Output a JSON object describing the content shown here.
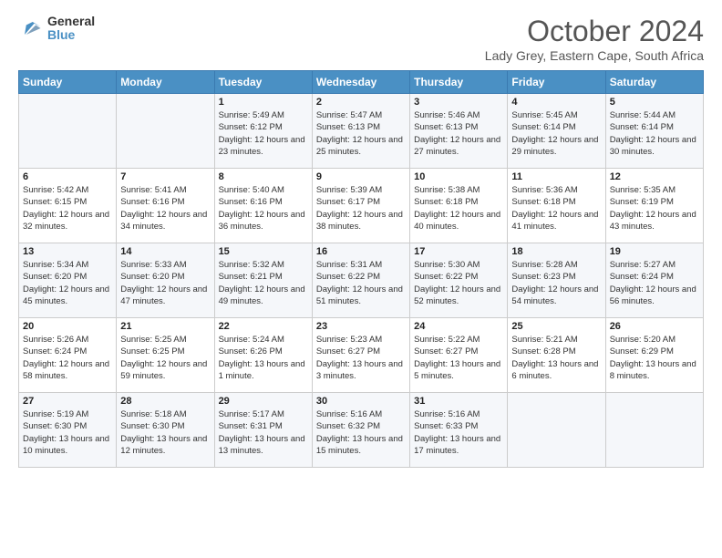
{
  "header": {
    "logo_general": "General",
    "logo_blue": "Blue",
    "month_title": "October 2024",
    "location": "Lady Grey, Eastern Cape, South Africa"
  },
  "days_of_week": [
    "Sunday",
    "Monday",
    "Tuesday",
    "Wednesday",
    "Thursday",
    "Friday",
    "Saturday"
  ],
  "weeks": [
    [
      {
        "day": "",
        "info": ""
      },
      {
        "day": "",
        "info": ""
      },
      {
        "day": "1",
        "info": "Sunrise: 5:49 AM\nSunset: 6:12 PM\nDaylight: 12 hours and 23 minutes."
      },
      {
        "day": "2",
        "info": "Sunrise: 5:47 AM\nSunset: 6:13 PM\nDaylight: 12 hours and 25 minutes."
      },
      {
        "day": "3",
        "info": "Sunrise: 5:46 AM\nSunset: 6:13 PM\nDaylight: 12 hours and 27 minutes."
      },
      {
        "day": "4",
        "info": "Sunrise: 5:45 AM\nSunset: 6:14 PM\nDaylight: 12 hours and 29 minutes."
      },
      {
        "day": "5",
        "info": "Sunrise: 5:44 AM\nSunset: 6:14 PM\nDaylight: 12 hours and 30 minutes."
      }
    ],
    [
      {
        "day": "6",
        "info": "Sunrise: 5:42 AM\nSunset: 6:15 PM\nDaylight: 12 hours and 32 minutes."
      },
      {
        "day": "7",
        "info": "Sunrise: 5:41 AM\nSunset: 6:16 PM\nDaylight: 12 hours and 34 minutes."
      },
      {
        "day": "8",
        "info": "Sunrise: 5:40 AM\nSunset: 6:16 PM\nDaylight: 12 hours and 36 minutes."
      },
      {
        "day": "9",
        "info": "Sunrise: 5:39 AM\nSunset: 6:17 PM\nDaylight: 12 hours and 38 minutes."
      },
      {
        "day": "10",
        "info": "Sunrise: 5:38 AM\nSunset: 6:18 PM\nDaylight: 12 hours and 40 minutes."
      },
      {
        "day": "11",
        "info": "Sunrise: 5:36 AM\nSunset: 6:18 PM\nDaylight: 12 hours and 41 minutes."
      },
      {
        "day": "12",
        "info": "Sunrise: 5:35 AM\nSunset: 6:19 PM\nDaylight: 12 hours and 43 minutes."
      }
    ],
    [
      {
        "day": "13",
        "info": "Sunrise: 5:34 AM\nSunset: 6:20 PM\nDaylight: 12 hours and 45 minutes."
      },
      {
        "day": "14",
        "info": "Sunrise: 5:33 AM\nSunset: 6:20 PM\nDaylight: 12 hours and 47 minutes."
      },
      {
        "day": "15",
        "info": "Sunrise: 5:32 AM\nSunset: 6:21 PM\nDaylight: 12 hours and 49 minutes."
      },
      {
        "day": "16",
        "info": "Sunrise: 5:31 AM\nSunset: 6:22 PM\nDaylight: 12 hours and 51 minutes."
      },
      {
        "day": "17",
        "info": "Sunrise: 5:30 AM\nSunset: 6:22 PM\nDaylight: 12 hours and 52 minutes."
      },
      {
        "day": "18",
        "info": "Sunrise: 5:28 AM\nSunset: 6:23 PM\nDaylight: 12 hours and 54 minutes."
      },
      {
        "day": "19",
        "info": "Sunrise: 5:27 AM\nSunset: 6:24 PM\nDaylight: 12 hours and 56 minutes."
      }
    ],
    [
      {
        "day": "20",
        "info": "Sunrise: 5:26 AM\nSunset: 6:24 PM\nDaylight: 12 hours and 58 minutes."
      },
      {
        "day": "21",
        "info": "Sunrise: 5:25 AM\nSunset: 6:25 PM\nDaylight: 12 hours and 59 minutes."
      },
      {
        "day": "22",
        "info": "Sunrise: 5:24 AM\nSunset: 6:26 PM\nDaylight: 13 hours and 1 minute."
      },
      {
        "day": "23",
        "info": "Sunrise: 5:23 AM\nSunset: 6:27 PM\nDaylight: 13 hours and 3 minutes."
      },
      {
        "day": "24",
        "info": "Sunrise: 5:22 AM\nSunset: 6:27 PM\nDaylight: 13 hours and 5 minutes."
      },
      {
        "day": "25",
        "info": "Sunrise: 5:21 AM\nSunset: 6:28 PM\nDaylight: 13 hours and 6 minutes."
      },
      {
        "day": "26",
        "info": "Sunrise: 5:20 AM\nSunset: 6:29 PM\nDaylight: 13 hours and 8 minutes."
      }
    ],
    [
      {
        "day": "27",
        "info": "Sunrise: 5:19 AM\nSunset: 6:30 PM\nDaylight: 13 hours and 10 minutes."
      },
      {
        "day": "28",
        "info": "Sunrise: 5:18 AM\nSunset: 6:30 PM\nDaylight: 13 hours and 12 minutes."
      },
      {
        "day": "29",
        "info": "Sunrise: 5:17 AM\nSunset: 6:31 PM\nDaylight: 13 hours and 13 minutes."
      },
      {
        "day": "30",
        "info": "Sunrise: 5:16 AM\nSunset: 6:32 PM\nDaylight: 13 hours and 15 minutes."
      },
      {
        "day": "31",
        "info": "Sunrise: 5:16 AM\nSunset: 6:33 PM\nDaylight: 13 hours and 17 minutes."
      },
      {
        "day": "",
        "info": ""
      },
      {
        "day": "",
        "info": ""
      }
    ]
  ]
}
